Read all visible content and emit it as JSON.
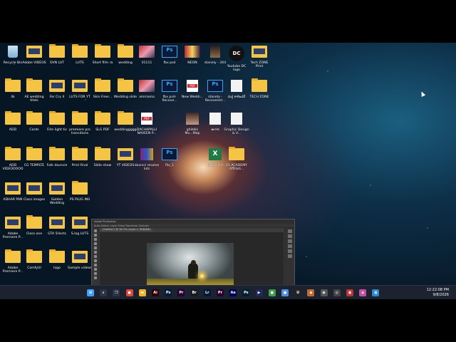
{
  "desktop": {
    "icons": [
      {
        "label": "Recycle Bin",
        "type": "recycle"
      },
      {
        "label": "Adobe VIDEOS",
        "type": "folder-thumb"
      },
      {
        "label": "OVN LUT",
        "type": "folder"
      },
      {
        "label": "LUTS",
        "type": "folder"
      },
      {
        "label": "Short film ra",
        "type": "folder"
      },
      {
        "label": "wedding",
        "type": "folder"
      },
      {
        "label": "01111",
        "type": "img"
      },
      {
        "label": "fbx psd",
        "type": "psd"
      },
      {
        "label": "NEON",
        "type": "neon"
      },
      {
        "label": "stanely - 3X4",
        "type": "staeply"
      },
      {
        "label": "Youtube DC logo",
        "type": "dc"
      },
      {
        "label": "Tech ZONE Print",
        "type": "folder-thumb"
      },
      {
        "label": "4k",
        "type": "folder"
      },
      {
        "label": "AE wedding titels",
        "type": "folder"
      },
      {
        "label": "Far Cry 4",
        "type": "folder-thumb"
      },
      {
        "label": "LUTS FOR YT",
        "type": "folder-thumb"
      },
      {
        "label": "Skin Finer...",
        "type": "folder"
      },
      {
        "label": "Wedding slide",
        "type": "folder"
      },
      {
        "label": "ammama",
        "type": "img"
      },
      {
        "label": "fbx psd-Recove...",
        "type": "psd"
      },
      {
        "label": "New Weddi...",
        "type": "pdf"
      },
      {
        "label": "stanely -Recovered...",
        "type": "psd"
      },
      {
        "label": "దుర్గ కాలెండర్",
        "type": "doc"
      },
      {
        "label": "TECH ZONE",
        "type": "folder"
      },
      {
        "label": "ADD",
        "type": "folder"
      },
      {
        "label": "Cards",
        "type": "folder"
      },
      {
        "label": "Film light tic",
        "type": "folder"
      },
      {
        "label": "premiere pro transitions",
        "type": "folder"
      },
      {
        "label": "SLG PDF",
        "type": "folder"
      },
      {
        "label": "weddinggggg",
        "type": "folder"
      },
      {
        "label": "DACHAPALLI NAVEEN P...",
        "type": "pdf"
      },
      {
        "label": "ghibliki Mu...Map",
        "type": "person"
      },
      {
        "label": "ఉగాది",
        "type": "doc"
      },
      {
        "label": "Graphic Design & V...",
        "type": "doc"
      },
      {
        "label": "ADD VIDEOOOOO",
        "type": "folder"
      },
      {
        "label": "CG TEMPLTE",
        "type": "folder"
      },
      {
        "label": "Folk davncie",
        "type": "folder"
      },
      {
        "label": "Print Final",
        "type": "folder"
      },
      {
        "label": "Slide show",
        "type": "folder"
      },
      {
        "label": "YT VIDEOS",
        "type": "folder-thumb"
      },
      {
        "label": "davinci resolve luts",
        "type": "winrar"
      },
      {
        "label": "flix_1",
        "type": "psd"
      },
      {
        "label": "LOGO 0.0",
        "type": "excel"
      },
      {
        "label": "01 ACADEMY Affiliati...",
        "type": "folder"
      },
      {
        "label": "ADHAR PAN",
        "type": "folder-thumb"
      },
      {
        "label": "Class images",
        "type": "folder-thumb"
      },
      {
        "label": "Golden Wedding",
        "type": "folder-thumb"
      },
      {
        "label": "PS PLUG INS",
        "type": "folder"
      },
      {
        "label": "Adobe Premiere P...",
        "type": "folder-thumb"
      },
      {
        "label": "Class one",
        "type": "folder"
      },
      {
        "label": "GTA 5Horts",
        "type": "folder-thumb"
      },
      {
        "label": "S.log LUTS",
        "type": "folder-thumb"
      },
      {
        "label": "Adobe Premiere P...",
        "type": "folder"
      },
      {
        "label": "ComfyUI",
        "type": "folder"
      },
      {
        "label": "logo",
        "type": "folder"
      },
      {
        "label": "Sample videos",
        "type": "folder-thumb"
      }
    ]
  },
  "photoshop": {
    "title": "Adobe Photoshop",
    "options_bar": "Auto-Select: Layer  Show Transform Controls",
    "doc_tab": "Untitled-1 @ 16.7% (Layer 1, RGB/8#)",
    "status": "16.67%"
  },
  "taskbar": {
    "apps": [
      {
        "name": "start-button",
        "glyph": "⊞",
        "color": "#3fa0ff"
      },
      {
        "name": "search",
        "glyph": "⌕",
        "color": "#2c3444"
      },
      {
        "name": "task-view",
        "glyph": "❐",
        "color": "#2c3444"
      },
      {
        "name": "chrome",
        "glyph": "●",
        "color": "#e0463a"
      },
      {
        "name": "file-explorer",
        "glyph": "▬",
        "color": "#f0b429"
      },
      {
        "name": "illustrator",
        "glyph": "Ai",
        "color": "#330000"
      },
      {
        "name": "photoshop",
        "glyph": "Ps",
        "color": "#001e36"
      },
      {
        "name": "premiere",
        "glyph": "Pr",
        "color": "#2a0033"
      },
      {
        "name": "bridge",
        "glyph": "Br",
        "color": "#1a1b1d"
      },
      {
        "name": "lightroom",
        "glyph": "Lr",
        "color": "#001a33"
      },
      {
        "name": "premiere-2",
        "glyph": "Pr",
        "color": "#2a0033"
      },
      {
        "name": "after-effects",
        "glyph": "Ae",
        "color": "#00005b"
      },
      {
        "name": "photoshop-2",
        "glyph": "Ps",
        "color": "#001e36"
      },
      {
        "name": "media-encoder",
        "glyph": "▶",
        "color": "#1e2a5a"
      },
      {
        "name": "chrome-2",
        "glyph": "●",
        "color": "#3f9e46"
      },
      {
        "name": "chrome-3",
        "glyph": "●",
        "color": "#4f8fe0"
      },
      {
        "name": "unreal",
        "glyph": "U",
        "color": "#222"
      },
      {
        "name": "app-a",
        "glyph": "◆",
        "color": "#c06b2b"
      },
      {
        "name": "app-b",
        "glyph": "◉",
        "color": "#555"
      },
      {
        "name": "app-c",
        "glyph": "◎",
        "color": "#444"
      },
      {
        "name": "app-d",
        "glyph": "▣",
        "color": "#b33"
      },
      {
        "name": "app-e",
        "glyph": "◈",
        "color": "#c44fa0"
      },
      {
        "name": "app-f",
        "glyph": "▦",
        "color": "#2f86c9"
      }
    ],
    "time": "12:22:08 PM",
    "date": "9/8/2026"
  }
}
